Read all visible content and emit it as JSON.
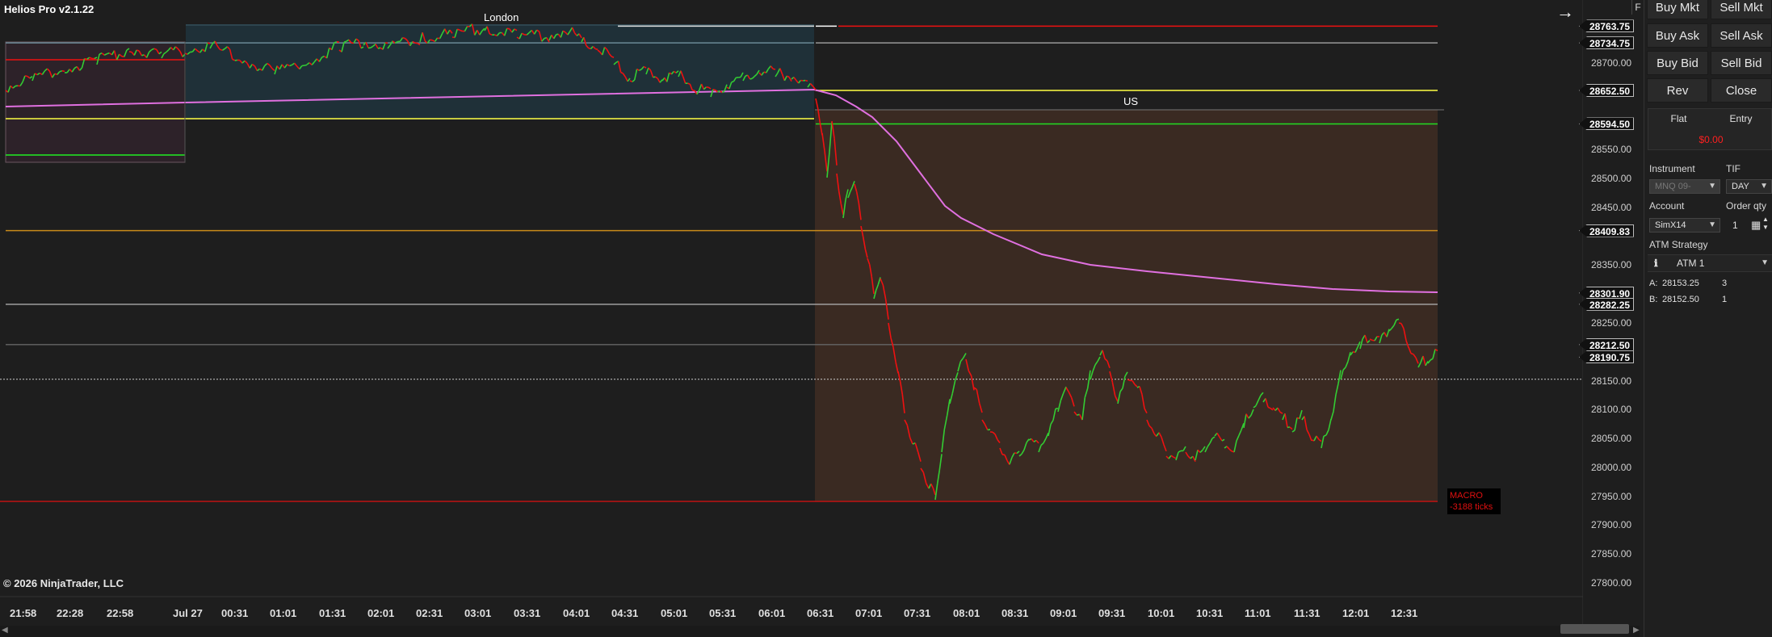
{
  "app": {
    "title": "Helios Pro v2.1.22",
    "copyright": "© 2026 NinjaTrader, LLC"
  },
  "sessions": {
    "london": "London",
    "us": "US"
  },
  "macro": {
    "label": "MACRO",
    "ticks": "-3188 ticks"
  },
  "price_tags": [
    {
      "value": "28763.75",
      "price": 28763.75,
      "color": "#111111"
    },
    {
      "value": "28734.75",
      "price": 28734.75,
      "color": "#111111"
    },
    {
      "value": "28652.50",
      "price": 28652.5,
      "color": "#111111"
    },
    {
      "value": "28594.50",
      "price": 28594.5,
      "color": "#111111"
    },
    {
      "value": "28409.83",
      "price": 28409.83,
      "color": "#111111"
    },
    {
      "value": "28301.90",
      "price": 28301.9,
      "color": "#111111"
    },
    {
      "value": "28282.25",
      "price": 28282.25,
      "color": "#111111"
    },
    {
      "value": "28212.50",
      "price": 28212.5,
      "color": "#111111"
    },
    {
      "value": "28190.75",
      "price": 28190.75,
      "color": "#111111"
    }
  ],
  "price_axis": [
    "28700.00",
    "28550.00",
    "28500.00",
    "28450.00",
    "28350.00",
    "28250.00",
    "28150.00",
    "28100.00",
    "28050.00",
    "28000.00",
    "27950.00",
    "27900.00",
    "27850.00",
    "27800.00"
  ],
  "time_axis": [
    "21:58",
    "22:28",
    "22:58",
    "Jul 27",
    "00:31",
    "01:01",
    "01:31",
    "02:01",
    "02:31",
    "03:01",
    "03:31",
    "04:01",
    "04:31",
    "05:01",
    "05:31",
    "06:01",
    "06:31",
    "07:01",
    "07:31",
    "08:01",
    "08:31",
    "09:01",
    "09:31",
    "10:01",
    "10:31",
    "11:01",
    "11:31",
    "12:01",
    "12:31"
  ],
  "panel": {
    "buy_mkt": "Buy Mkt",
    "sell_mkt": "Sell Mkt",
    "buy_ask": "Buy Ask",
    "sell_ask": "Sell Ask",
    "buy_bid": "Buy Bid",
    "sell_bid": "Sell Bid",
    "rev": "Rev",
    "close": "Close",
    "position": "Flat",
    "entry": "Entry",
    "pnl": "$0.00",
    "instrument_label": "Instrument",
    "instrument_value": "MNQ 09-",
    "tif_label": "TIF",
    "tif_value": "DAY",
    "account_label": "Account",
    "account_value": "SimX14",
    "qty_label": "Order qty",
    "qty_value": "1",
    "atm_label": "ATM Strategy",
    "atm_value": "ATM 1",
    "ask_label": "A:",
    "ask_price": "28153.25",
    "ask_size": "3",
    "bid_label": "B:",
    "bid_price": "28152.50",
    "bid_size": "1",
    "f_label": "F"
  },
  "colors": {
    "bull": "#33cc33",
    "bear": "#ee1111",
    "vwap": "#e070e0",
    "macro_zone": "#3a2a22"
  }
}
